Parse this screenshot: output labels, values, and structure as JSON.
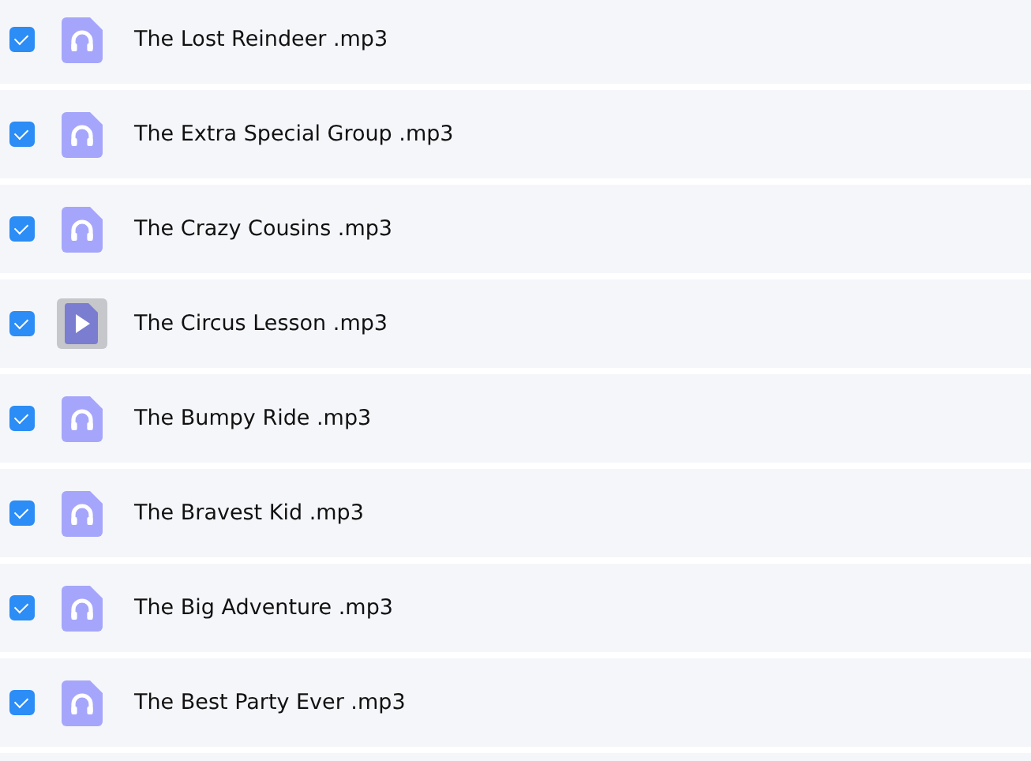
{
  "files": [
    {
      "name": "The Lost Reindeer .mp3",
      "checked": true,
      "kind": "audio"
    },
    {
      "name": "The Extra Special Group .mp3",
      "checked": true,
      "kind": "audio"
    },
    {
      "name": "The Crazy Cousins .mp3",
      "checked": true,
      "kind": "audio"
    },
    {
      "name": "The Circus Lesson .mp3",
      "checked": true,
      "kind": "playing"
    },
    {
      "name": "The Bumpy Ride .mp3",
      "checked": true,
      "kind": "audio"
    },
    {
      "name": "The Bravest Kid .mp3",
      "checked": true,
      "kind": "audio"
    },
    {
      "name": "The Big Adventure .mp3",
      "checked": true,
      "kind": "audio"
    },
    {
      "name": "The Best Party Ever .mp3",
      "checked": true,
      "kind": "audio"
    }
  ]
}
